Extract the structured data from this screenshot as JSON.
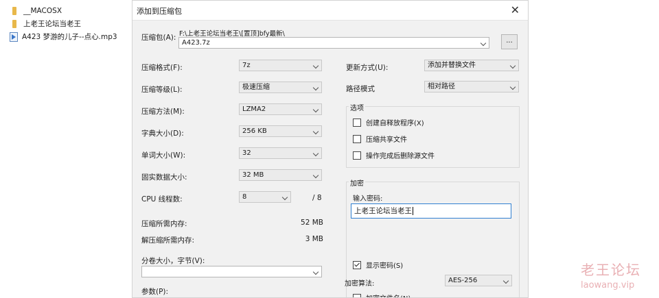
{
  "explorer": {
    "items": [
      {
        "name": "__MACOSX",
        "icon": "folder-icon"
      },
      {
        "name": "上老王论坛当老王",
        "icon": "folder-icon"
      },
      {
        "name": "A423 梦游的儿子--点心.mp3",
        "icon": "audio-file-icon"
      }
    ]
  },
  "dialog": {
    "title": "添加到压缩包",
    "close_glyph": "✕",
    "archive_label": "压缩包(A):",
    "archive_path": "F:\\上老王论坛当老王\\[置顶]bfy最新\\",
    "archive_name": "A423.7z",
    "browse_label": "...",
    "format_label": "压缩格式(F):",
    "format_value": "7z",
    "level_label": "压缩等级(L):",
    "level_value": "极速压缩",
    "method_label": "压缩方法(M):",
    "method_value": "LZMA2",
    "dict_label": "字典大小(D):",
    "dict_value": "256 KB",
    "word_label": "单词大小(W):",
    "word_value": "32",
    "solid_label": "固实数据大小:",
    "solid_value": "32 MB",
    "cpu_label": "CPU 线程数:",
    "cpu_value": "8",
    "cpu_total": "/ 8",
    "mem_compress_label": "压缩所需内存:",
    "mem_compress_value": "52 MB",
    "mem_decompress_label": "解压缩所需内存:",
    "mem_decompress_value": "3 MB",
    "split_label": "分卷大小，字节(V):",
    "split_value": "",
    "params_label": "参数(P):",
    "update_label": "更新方式(U):",
    "update_value": "添加并替换文件",
    "path_mode_label": "路径模式",
    "path_mode_value": "相对路径",
    "options_title": "选项",
    "options": [
      {
        "label": "创建自释放程序(X)",
        "checked": false
      },
      {
        "label": "压缩共享文件",
        "checked": false
      },
      {
        "label": "操作完成后删除源文件",
        "checked": false
      }
    ],
    "encryption_title": "加密",
    "password_label": "输入密码:",
    "password_value": "上老王论坛当老王",
    "show_password_label": "显示密码(S)",
    "show_password_checked": true,
    "enc_method_label": "加密算法:",
    "enc_method_value": "AES-256",
    "encrypt_names_label": "加密文件名(N)"
  },
  "watermark": {
    "line1": "老王论坛",
    "line2": "laowang.vip"
  },
  "colors": {
    "dialog_bg": "#f1f1f1",
    "focus_border": "#2f7fd1",
    "watermark": "#e9b0b4"
  }
}
